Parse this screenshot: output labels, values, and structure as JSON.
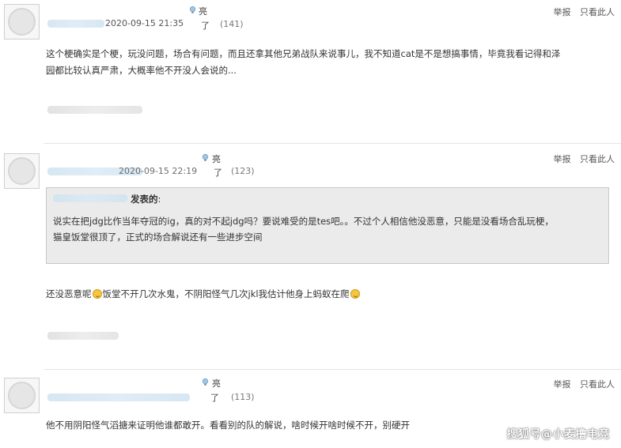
{
  "comments": [
    {
      "timestamp": "2020-09-15 21:35",
      "liang_label": "亮",
      "liang_suffix": "了",
      "count": "(141)",
      "report_label": "举报",
      "only_view_label": "只看此人",
      "text_lines": [
        "这个梗确实是个梗，玩没问题，场合有问题，而且还拿其他兄弟战队来说事儿，我不知道cat是不是想搞事情，毕竟我看记得和泽",
        "园都比较认真严肃，大概率他不开没人会说的..."
      ]
    },
    {
      "timestamp": "2020-09-15 22:19",
      "liang_label": "亮",
      "liang_suffix": "了",
      "count": "(123)",
      "report_label": "举报",
      "only_view_label": "只看此人",
      "quote_author_label": "发表的",
      "quote_colon": ":",
      "quote_lines": [
        "说实在把jdg比作当年夺冠的ig，真的对不起jdg吗？要说难受的是tes吧。。不过个人相信他没恶意，只能是没看场合乱玩梗，",
        "猫皇饭堂很顶了，正式的场合解说还有一些进步空间"
      ],
      "text_part1": "还没恶意呢",
      "text_part2": "饭堂不开几次水鬼，不阴阳怪气几次jkl我估计他身上蚂蚁在爬"
    },
    {
      "liang_label": "亮",
      "liang_suffix": "了",
      "count": "(113)",
      "report_label": "举报",
      "only_view_label": "只看此人",
      "text_lines": [
        "他不用阴阳怪气滔搪来证明他谁都敢开。看看别的队的解说，啥时候开啥时候不开，别硬开"
      ]
    }
  ],
  "watermark": "搜狐号@小麦撸电竞",
  "icons": {
    "bulb": "lightbulb-icon",
    "emoji": "emoji-icon"
  },
  "colors": {
    "divider": "#e4e4e4",
    "quote_bg": "#ebebeb",
    "quote_border": "#c8c8c8"
  }
}
